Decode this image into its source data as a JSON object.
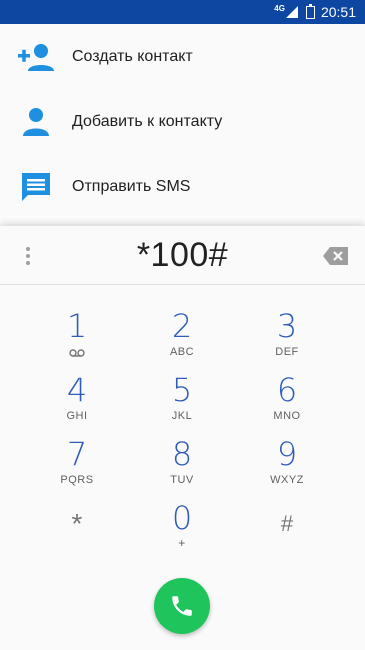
{
  "status_bar": {
    "network": "4G",
    "time": "20:51"
  },
  "actions": [
    {
      "label": "Создать контакт",
      "icon": "add-contact-icon"
    },
    {
      "label": "Добавить к контакту",
      "icon": "contact-icon"
    },
    {
      "label": "Отправить SMS",
      "icon": "sms-icon"
    }
  ],
  "dialer": {
    "digits": "*100#",
    "keys": [
      {
        "digit": "1",
        "letters": ""
      },
      {
        "digit": "2",
        "letters": "ABC"
      },
      {
        "digit": "3",
        "letters": "DEF"
      },
      {
        "digit": "4",
        "letters": "GHI"
      },
      {
        "digit": "5",
        "letters": "JKL"
      },
      {
        "digit": "6",
        "letters": "MNO"
      },
      {
        "digit": "7",
        "letters": "PQRS"
      },
      {
        "digit": "8",
        "letters": "TUV"
      },
      {
        "digit": "9",
        "letters": "WXYZ"
      },
      {
        "digit": "*",
        "letters": ""
      },
      {
        "digit": "0",
        "letters": "+"
      },
      {
        "digit": "#",
        "letters": ""
      }
    ]
  },
  "colors": {
    "status_bar": "#0d47a1",
    "accent_blue": "#1f8fe0",
    "key_digit": "#2e5cb8",
    "call_green": "#1fc55c"
  }
}
